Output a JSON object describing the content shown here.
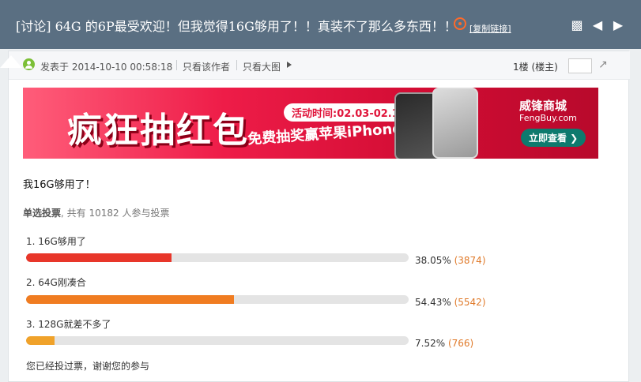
{
  "thread": {
    "title": "[讨论] 64G 的6P最受欢迎！但我觉得16G够用了！！真装不了那么多东西！！",
    "copy_link": "[复制链接]",
    "icons": [
      "fire-icon",
      "print-icon",
      "prev-icon",
      "next-icon"
    ]
  },
  "post_meta": {
    "posted_at": "发表于 2014-10-10 00:58:18",
    "only_author": "只看该作者",
    "big_image": "只看大图",
    "floor": "1楼 (楼主)"
  },
  "banner": {
    "headline": "疯狂抽红包",
    "activity_time": "活动时间:02.03-02.12",
    "subline": "免费抽奖赢苹果iPhone6",
    "brand": "威锋商城",
    "brand_url": "FengBuy.com",
    "cta": "立即查看 ❯"
  },
  "post": {
    "text": "我16G够用了！"
  },
  "poll": {
    "type_label": "单选投票",
    "participants": ", 共有 10182 人参与投票",
    "options": [
      {
        "label": "1.  16G够用了",
        "percent": 38.05,
        "percent_text": "38.05%",
        "count": "(3874)",
        "color": "#e8362a"
      },
      {
        "label": "2.  64G刚凑合",
        "percent": 54.43,
        "percent_text": "54.43%",
        "count": "(5542)",
        "color": "#f07c21"
      },
      {
        "label": "3.  128G就差不多了",
        "percent": 7.52,
        "percent_text": "7.52%",
        "count": "(766)",
        "color": "#f0a22a"
      }
    ],
    "voted_message": "您已经投过票，谢谢您的参与"
  }
}
